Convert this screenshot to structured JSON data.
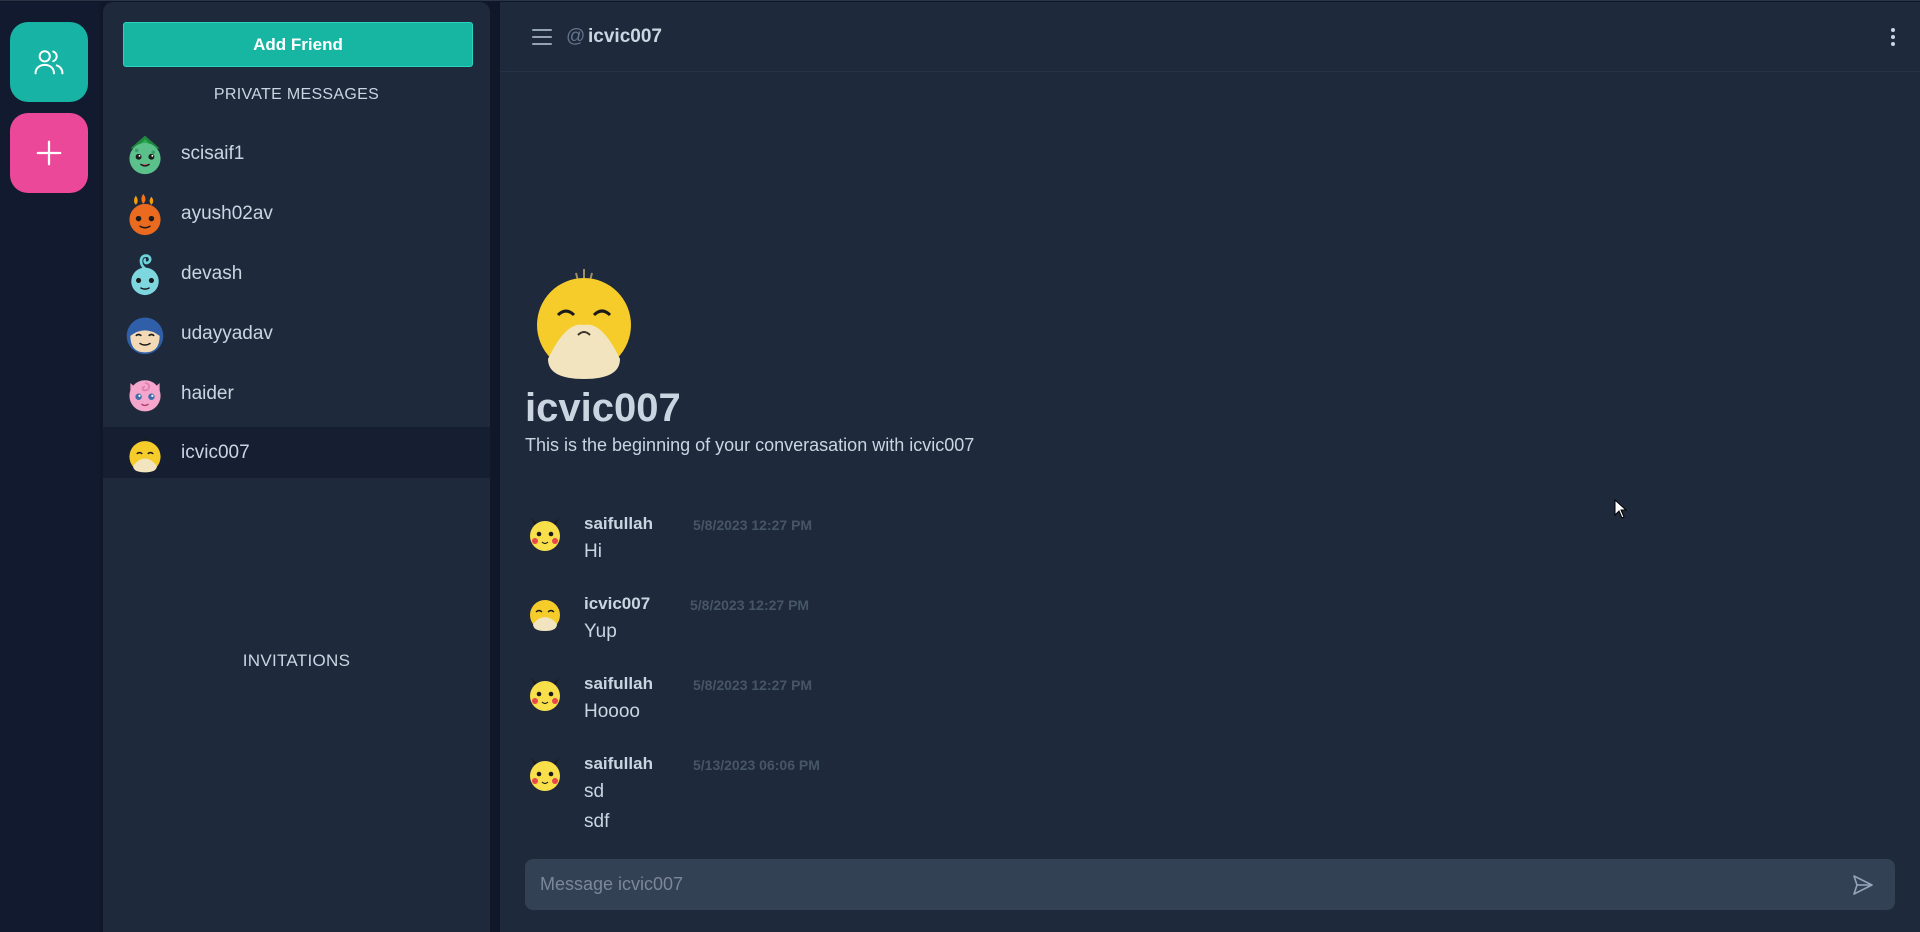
{
  "rail": {
    "friends_icon": "friends-icon",
    "add_icon": "plus-icon",
    "friends_color": "#17b3a4",
    "add_color": "#ec4899"
  },
  "sidebar": {
    "add_friend_label": "Add Friend",
    "pm_title": "PRIVATE MESSAGES",
    "invitations_title": "INVITATIONS",
    "friends": [
      {
        "name": "scisaif1",
        "avatar": "bulbasaur-avatar"
      },
      {
        "name": "ayush02av",
        "avatar": "charmander-avatar"
      },
      {
        "name": "devash",
        "avatar": "squirtle-avatar"
      },
      {
        "name": "udayyadav",
        "avatar": "snorlax-avatar"
      },
      {
        "name": "haider",
        "avatar": "jigglypuff-avatar"
      },
      {
        "name": "icvic007",
        "avatar": "psyduck-avatar",
        "active": true
      }
    ]
  },
  "header": {
    "at": "@",
    "username": "icvic007"
  },
  "hero": {
    "name": "icvic007",
    "subtitle": "This is the beginning of your converasation with icvic007"
  },
  "messages": [
    {
      "author": "saifullah",
      "time": "5/8/2023 12:27 PM",
      "lines": [
        "Hi"
      ],
      "avatar": "pikachu-avatar"
    },
    {
      "author": "icvic007",
      "time": "5/8/2023 12:27 PM",
      "lines": [
        "Yup"
      ],
      "avatar": "psyduck-avatar"
    },
    {
      "author": "saifullah",
      "time": "5/8/2023 12:27 PM",
      "lines": [
        "Hoooo"
      ],
      "avatar": "pikachu-avatar"
    },
    {
      "author": "saifullah",
      "time": "5/13/2023 06:06 PM",
      "lines": [
        "sd",
        "sdf"
      ],
      "avatar": "pikachu-avatar"
    }
  ],
  "composer": {
    "placeholder": "Message icvic007",
    "value": ""
  }
}
